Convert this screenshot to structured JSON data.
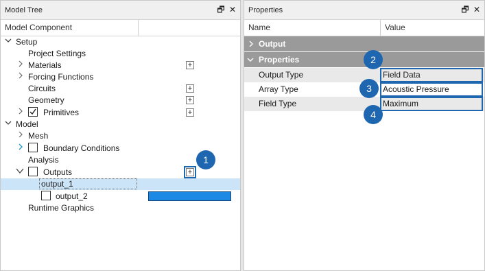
{
  "left_panel": {
    "title": "Model Tree",
    "columns": [
      "Model Component"
    ],
    "tree": {
      "setup": "Setup",
      "project_settings": "Project Settings",
      "materials": "Materials",
      "forcing_functions": "Forcing Functions",
      "circuits": "Circuits",
      "geometry": "Geometry",
      "primitives": "Primitives",
      "model": "Model",
      "mesh": "Mesh",
      "boundary_conditions": "Boundary Conditions",
      "analysis": "Analysis",
      "outputs": "Outputs",
      "output_1": "output_1",
      "output_2": "output_2",
      "runtime_graphics": "Runtime Graphics"
    },
    "add_button": "+"
  },
  "right_panel": {
    "title": "Properties",
    "columns": [
      "Name",
      "Value"
    ],
    "groups": [
      "Output",
      "Properties"
    ],
    "rows": [
      {
        "name": "Output Type",
        "value": "Field Data"
      },
      {
        "name": "Array Type",
        "value": "Acoustic Pressure"
      },
      {
        "name": "Field Type",
        "value": "Maximum"
      }
    ]
  },
  "window_buttons": {
    "pin": "🗗",
    "close": "✕"
  },
  "badges": [
    "1",
    "2",
    "3",
    "4"
  ],
  "colors": {
    "accent": "#1f66b0",
    "selection": "#cce4f7",
    "group_header": "#9a9a9a",
    "bar": "#1e88e5"
  }
}
